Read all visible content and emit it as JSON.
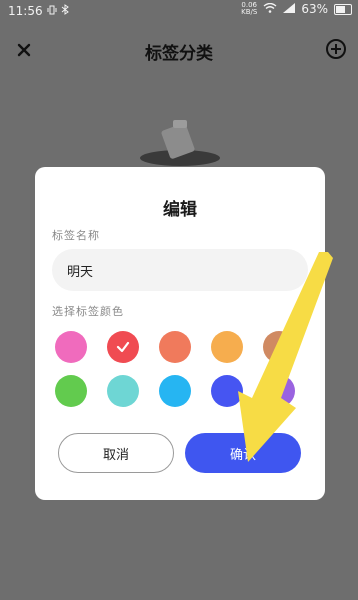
{
  "status_bar": {
    "time": "11:56",
    "net_speed_value": "0.06",
    "net_speed_unit": "KB/S",
    "battery": "63%"
  },
  "header": {
    "title": "标签分类"
  },
  "dialog": {
    "title": "编辑",
    "name_label": "标签名称",
    "name_value": "明天",
    "color_label": "选择标签颜色",
    "colors": [
      "#f06bbd",
      "#f04b52",
      "#f07a5c",
      "#f6ad4e",
      "#d08a62",
      "#62cb4e",
      "#6ed6d4",
      "#26b5f2",
      "#4655f2",
      "#9a63e0"
    ],
    "selected_color_index": 1,
    "cancel_label": "取消",
    "confirm_label": "确认"
  },
  "colors": {
    "accent": "#3f56f0",
    "backdrop": "#6e6e6e",
    "annotation_arrow": "#f7dc45"
  }
}
